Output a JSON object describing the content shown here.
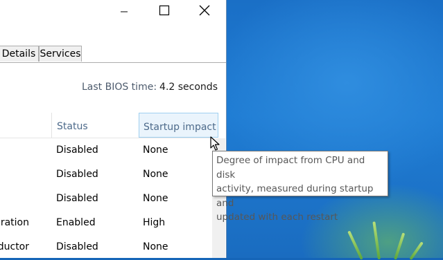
{
  "window": {
    "buttons": {
      "minimize": "minimize-icon",
      "maximize": "maximize-icon",
      "close": "close-icon"
    },
    "tabs": [
      {
        "label": "Details"
      },
      {
        "label": "Services"
      }
    ]
  },
  "startup": {
    "bios_label": "Last BIOS time:",
    "bios_value": "4.2 seconds",
    "columns": {
      "status": "Status",
      "impact": "Startup impact"
    },
    "rows": [
      {
        "name": "",
        "status": "Disabled",
        "impact": "None"
      },
      {
        "name": "",
        "status": "Disabled",
        "impact": "None"
      },
      {
        "name": "",
        "status": "Disabled",
        "impact": "None"
      },
      {
        "name": "ration",
        "status": "Enabled",
        "impact": "High"
      },
      {
        "name": "nductor",
        "status": "Disabled",
        "impact": "None"
      }
    ]
  },
  "tooltip": {
    "line1": "Degree of impact from CPU and disk",
    "line2": "activity, measured during startup and",
    "line3": "updated with each restart"
  },
  "colors": {
    "desktop": "#1a6fc6",
    "header_highlight": "#eaf4fc",
    "header_border": "#9fd0f0",
    "column_text": "#4d6a8a"
  }
}
